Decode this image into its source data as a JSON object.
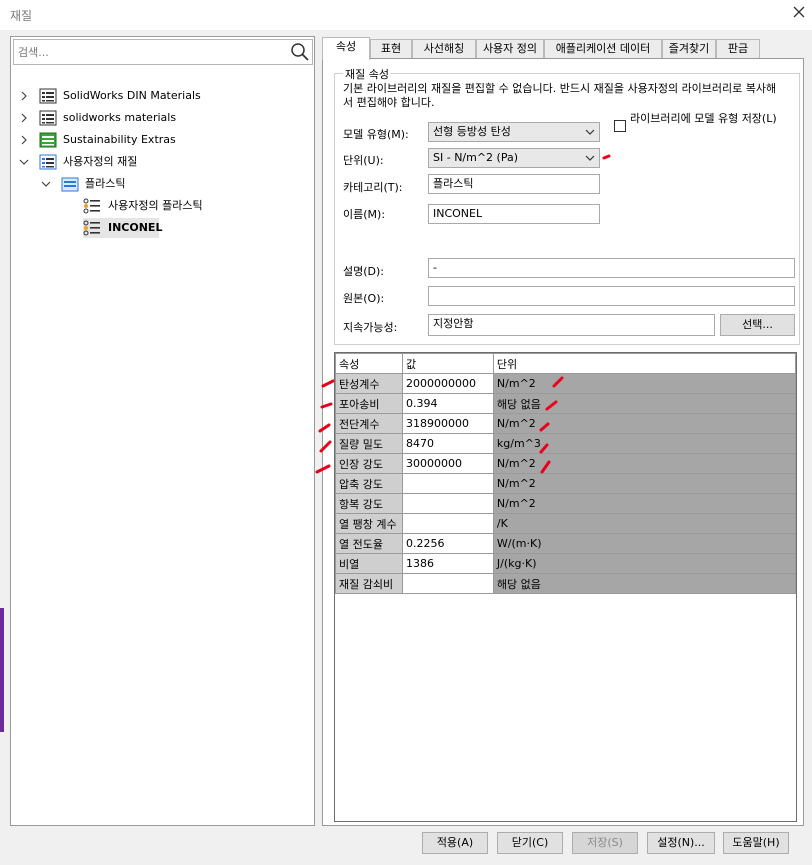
{
  "window": {
    "title": "재질"
  },
  "search": {
    "placeholder": "검색..."
  },
  "tree": [
    {
      "label": "SolidWorks DIN Materials"
    },
    {
      "label": "solidworks materials"
    },
    {
      "label": "Sustainability Extras"
    },
    {
      "label": "사용자정의 재질"
    },
    {
      "label": "플라스틱"
    },
    {
      "label": "사용자정의 플라스틱"
    },
    {
      "label": "INCONEL"
    }
  ],
  "tabs": [
    "속성",
    "표현",
    "사선해칭",
    "사용자 정의",
    "애플리케이션 데이터",
    "즐겨찾기",
    "판금"
  ],
  "props": {
    "group_title": "재질 속성",
    "warning": "기본 라이브러리의 재질을 편집할 수 없습니다. 반드시 재질을 사용자정의 라이브러리로 복사해서 편집해야 합니다.",
    "model_type_label": "모델 유형(M):",
    "model_type_value": "선형 등방성 탄성",
    "save_model_type_label": "라이브러리에 모델 유형 저장(L)",
    "units_label": "단위(U):",
    "units_value": "SI - N/m^2 (Pa)",
    "category_label": "카테고리(T):",
    "category_value": "플라스틱",
    "name_label": "이름(M):",
    "name_value": "INCONEL",
    "description_label": "설명(D):",
    "description_value": "-",
    "source_label": "원본(O):",
    "source_value": "",
    "sustainability_label": "지속가능성:",
    "sustainability_value": "지정안함",
    "select_button": "선택..."
  },
  "table": {
    "headers": [
      "속성",
      "값",
      "단위"
    ],
    "rows": [
      [
        "탄성계수",
        "2000000000",
        "N/m^2"
      ],
      [
        "포아송비",
        "0.394",
        "해당 없음"
      ],
      [
        "전단계수",
        "318900000",
        "N/m^2"
      ],
      [
        "질량 밀도",
        "8470",
        "kg/m^3"
      ],
      [
        "인장 강도",
        "30000000",
        "N/m^2"
      ],
      [
        "압축 강도",
        "",
        "N/m^2"
      ],
      [
        "항복 강도",
        "",
        "N/m^2"
      ],
      [
        "열 팽창 계수",
        "",
        "/K"
      ],
      [
        "열 전도율",
        "0.2256",
        "W/(m·K)"
      ],
      [
        "비열",
        "1386",
        "J/(kg·K)"
      ],
      [
        "재질 감쇠비",
        "",
        "해당 없음"
      ]
    ]
  },
  "buttons": {
    "apply": "적용(A)",
    "close": "닫기(C)",
    "save": "저장(S)",
    "config": "설정(N)...",
    "help": "도움말(H)"
  },
  "colors": {
    "annotation": "#e8001c",
    "folder_blue": "#2a7ad0",
    "folder_green": "#3aa53a"
  }
}
